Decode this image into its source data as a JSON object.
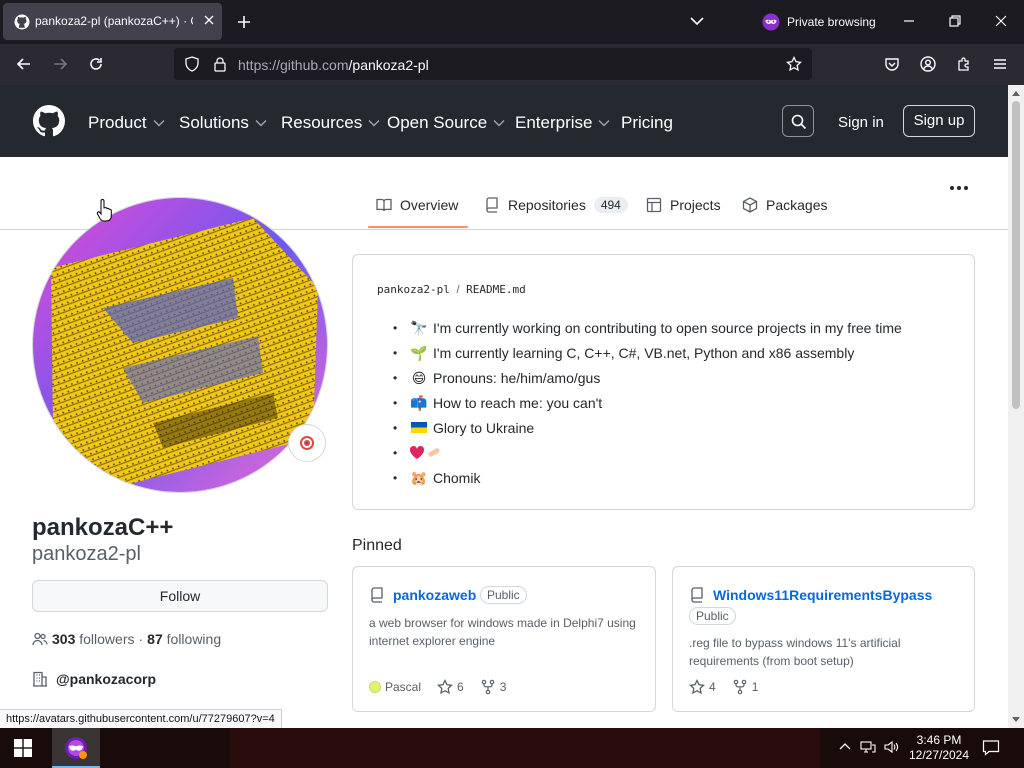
{
  "browser": {
    "tab_title": "pankoza2-pl (pankozaC++) · GitHub",
    "private_label": "Private browsing",
    "url_host": "https://github.com",
    "url_path": "/pankoza2-pl",
    "status_url": "https://avatars.githubusercontent.com/u/77279607?v=4"
  },
  "gh_header": {
    "nav": [
      {
        "label": "Product"
      },
      {
        "label": "Solutions"
      },
      {
        "label": "Resources"
      },
      {
        "label": "Open Source"
      },
      {
        "label": "Enterprise"
      },
      {
        "label": "Pricing"
      }
    ],
    "sign_in": "Sign in",
    "sign_up": "Sign up"
  },
  "profile_tabs": {
    "overview": "Overview",
    "repositories": "Repositories",
    "repositories_count": "494",
    "projects": "Projects",
    "packages": "Packages"
  },
  "profile": {
    "full_name": "pankozaC++",
    "username": "pankoza2-pl",
    "follow_label": "Follow",
    "followers_count": "303",
    "followers_label": "followers",
    "separator": "·",
    "following_count": "87",
    "following_label": "following",
    "org": "@pankozacorp"
  },
  "readme": {
    "owner": "pankoza2-pl",
    "sep": "/",
    "file": "README.md",
    "items": [
      {
        "emoji": "🔭",
        "text": "I'm currently working on contributing to open source projects in my free time"
      },
      {
        "emoji": "🌱",
        "text": "I'm currently learning C, C++, C#, VB.net, Python and x86 assembly"
      },
      {
        "emoji": "😄",
        "text": "Pronouns: he/him/amo/gus"
      },
      {
        "emoji": "📫",
        "text": "How to reach me: you can't"
      },
      {
        "emoji": "🇺🇦",
        "text": "Glory to Ukraine"
      },
      {
        "emoji": "❤️🩹",
        "text": ""
      },
      {
        "emoji": "🐹",
        "text": "Chomik"
      }
    ]
  },
  "pinned": {
    "title": "Pinned",
    "cards": [
      {
        "name": "pankozaweb",
        "visibility": "Public",
        "description": "a web browser for windows made in Delphi7 using internet explorer engine",
        "language": "Pascal",
        "language_color": "#E3F171",
        "stars": "6",
        "forks": "3"
      },
      {
        "name": "Windows11RequirementsBypass",
        "visibility": "Public",
        "description": ".reg file to bypass windows 11's artificial requirements (from boot setup)",
        "stars": "4",
        "forks": "1"
      }
    ]
  },
  "taskbar": {
    "time": "3:46 PM",
    "date": "12/27/2024"
  },
  "colors": {
    "gh_header_bg": "#24292f",
    "link": "#0969da",
    "tab_underline": "#fd8c73",
    "browser_bg": "#1c1b22"
  }
}
